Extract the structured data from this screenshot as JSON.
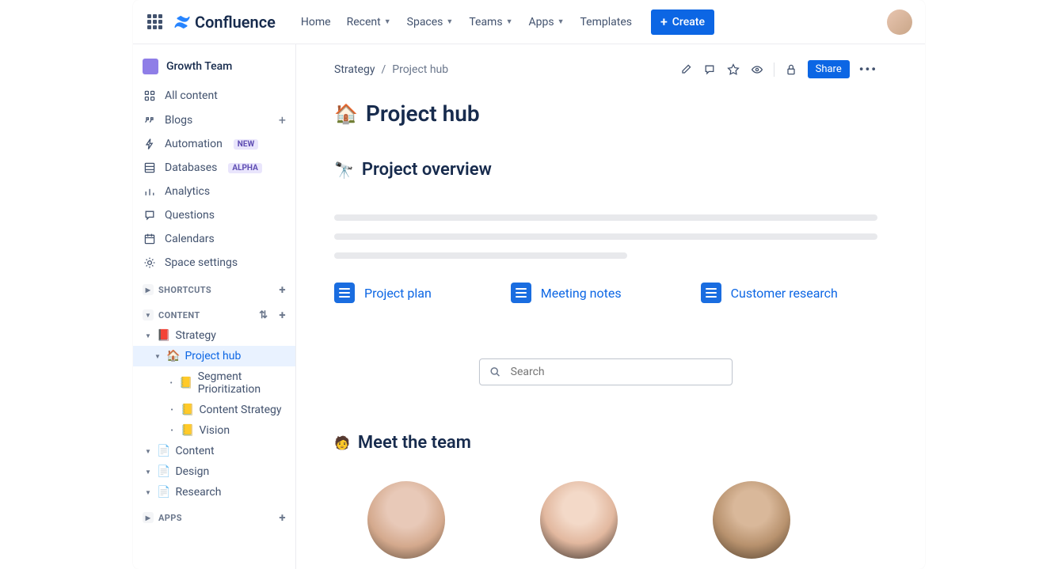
{
  "brand": "Confluence",
  "nav": {
    "home": "Home",
    "recent": "Recent",
    "spaces": "Spaces",
    "teams": "Teams",
    "apps": "Apps",
    "templates": "Templates",
    "create": "Create"
  },
  "sidebar": {
    "space_name": "Growth Team",
    "items": {
      "all_content": "All content",
      "blogs": "Blogs",
      "automation": "Automation",
      "automation_badge": "NEW",
      "databases": "Databases",
      "databases_badge": "ALPHA",
      "analytics": "Analytics",
      "questions": "Questions",
      "calendars": "Calendars",
      "space_settings": "Space settings"
    },
    "sections": {
      "shortcuts": "SHORTCUTS",
      "content": "CONTENT",
      "apps": "APPS"
    },
    "tree": {
      "strategy": "Strategy",
      "project_hub": "Project hub",
      "segment_prioritization": "Segment Prioritization",
      "content_strategy": "Content Strategy",
      "vision": "Vision",
      "content": "Content",
      "design": "Design",
      "research": "Research"
    }
  },
  "breadcrumb": {
    "parent": "Strategy",
    "current": "Project hub"
  },
  "actions": {
    "share": "Share"
  },
  "page": {
    "title": "Project hub",
    "overview_title": "Project overview",
    "team_title": "Meet the team"
  },
  "quick_links": {
    "plan": "Project plan",
    "notes": "Meeting notes",
    "research": "Customer research"
  },
  "search": {
    "placeholder": "Search"
  }
}
